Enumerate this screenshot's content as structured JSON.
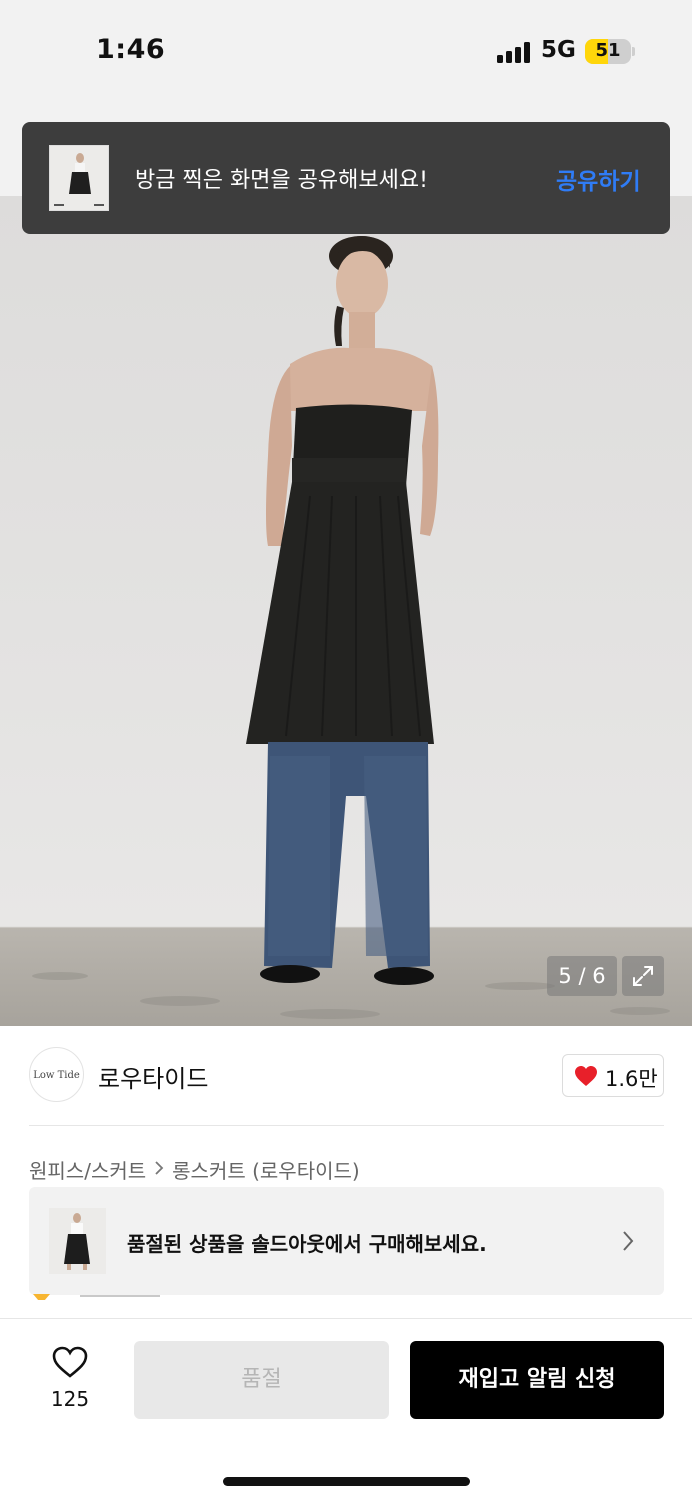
{
  "status_bar": {
    "time": "1:46",
    "network": "5G",
    "battery": "51",
    "battery_level": 0.51,
    "battery_color": "#ffd60a"
  },
  "share_toast": {
    "message": "방금 찍은 화면을 공유해보세요!",
    "action_label": "공유하기",
    "action_color": "#2f7cf6"
  },
  "gallery": {
    "counter": "5 / 6",
    "expand_icon": "expand-icon"
  },
  "brand": {
    "logo_text": "Low Tide",
    "name": "로우타이드",
    "like_icon": "heart-filled-icon",
    "like_count": "1.6만",
    "like_color": "#e8202a"
  },
  "breadcrumb": {
    "items": [
      "원피스/스커트",
      "롱스커트 (로우타이드)"
    ],
    "separator_icon": "chevron-right-icon"
  },
  "soldout_banner": {
    "text": "품절된 상품을 솔드아웃에서 구매해보세요.",
    "chevron_icon": "chevron-right-icon"
  },
  "bottom_bar": {
    "wishlist_icon": "heart-outline-icon",
    "wishlist_count": "125",
    "soldout_label": "품절",
    "restock_label": "재입고 알림 신청"
  }
}
